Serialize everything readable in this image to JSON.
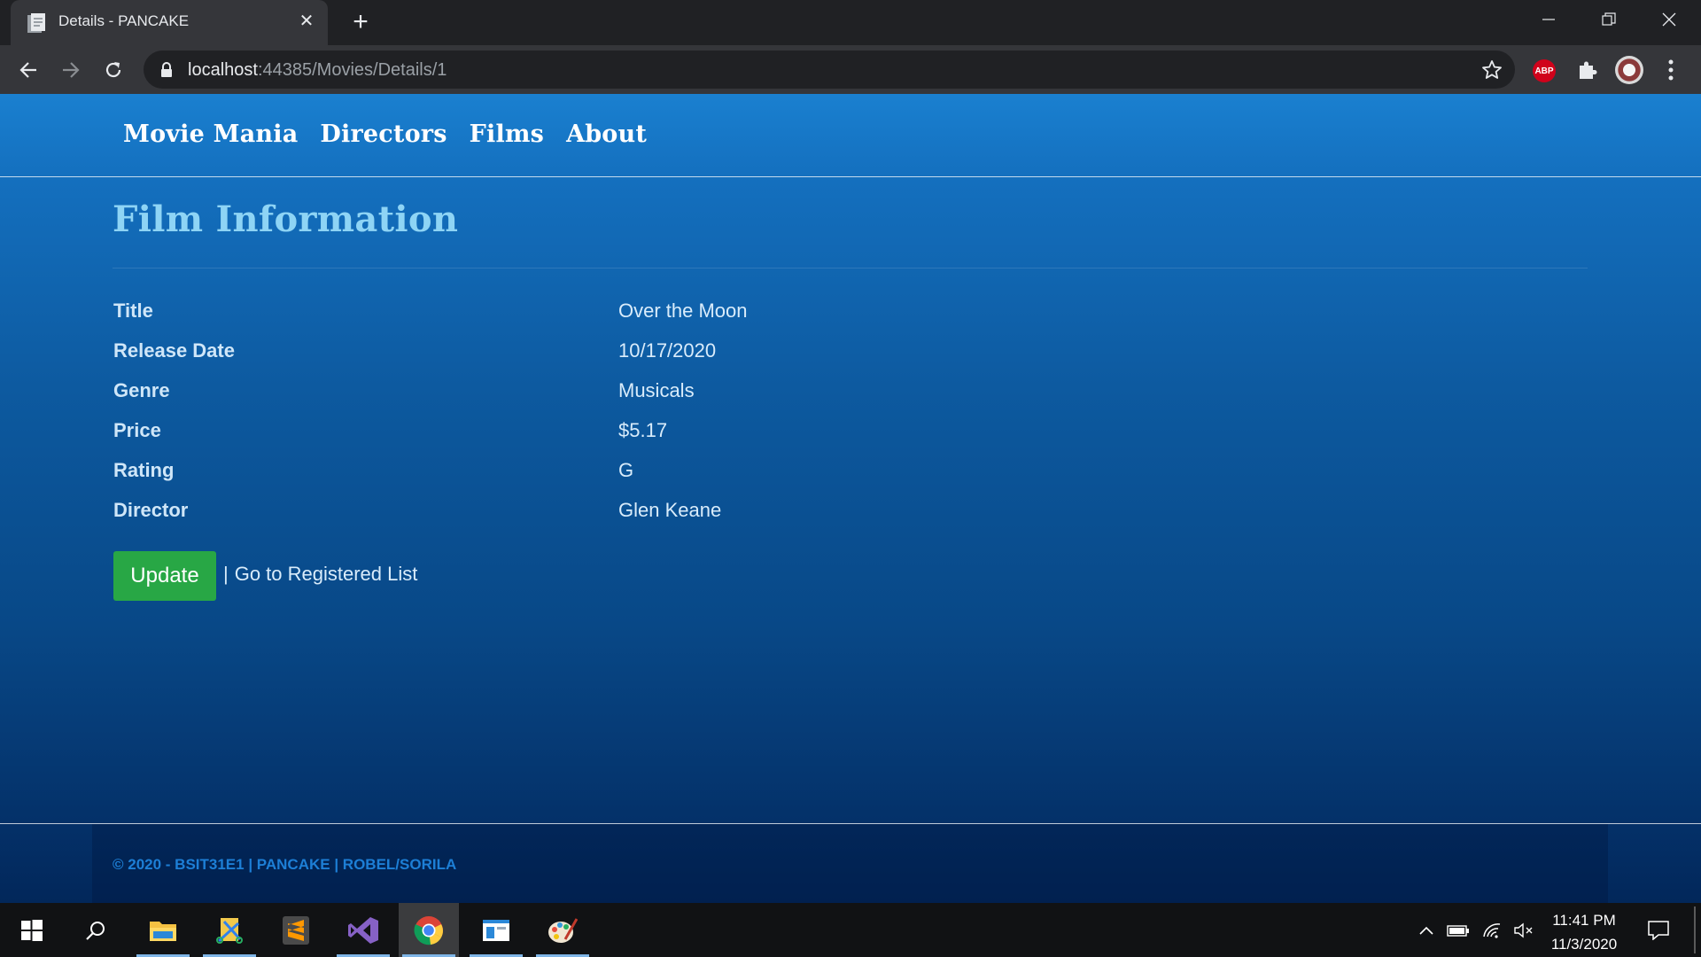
{
  "browser": {
    "tab_title": "Details - PANCAKE",
    "url_host": "localhost",
    "url_rest": ":44385/Movies/Details/1",
    "extension_badge": "ABP"
  },
  "nav": {
    "brand": "Movie Mania",
    "links": [
      "Directors",
      "Films",
      "About"
    ]
  },
  "page": {
    "title": "Film Information",
    "details": [
      {
        "label": "Title",
        "value": "Over the Moon"
      },
      {
        "label": "Release Date",
        "value": "10/17/2020"
      },
      {
        "label": "Genre",
        "value": "Musicals"
      },
      {
        "label": "Price",
        "value": "$5.17"
      },
      {
        "label": "Rating",
        "value": "G"
      },
      {
        "label": "Director",
        "value": "Glen Keane"
      }
    ],
    "update_label": "Update",
    "separator": "|",
    "list_link": "Go to Registered List"
  },
  "footer": {
    "text": "© 2020 - BSIT31E1 | PANCAKE | ROBEL/SORILA"
  },
  "taskbar": {
    "time": "11:41 PM",
    "date": "11/3/2020",
    "apps": [
      "file-explorer",
      "snipping-tool",
      "sublime-text",
      "visual-studio",
      "chrome",
      "window-app",
      "paint"
    ]
  },
  "colors": {
    "page_top": "#1a80d0",
    "page_bottom": "#02275a",
    "title": "#8ed4f5",
    "update_button": "#28a745",
    "footer_text": "#1d7fd6"
  }
}
